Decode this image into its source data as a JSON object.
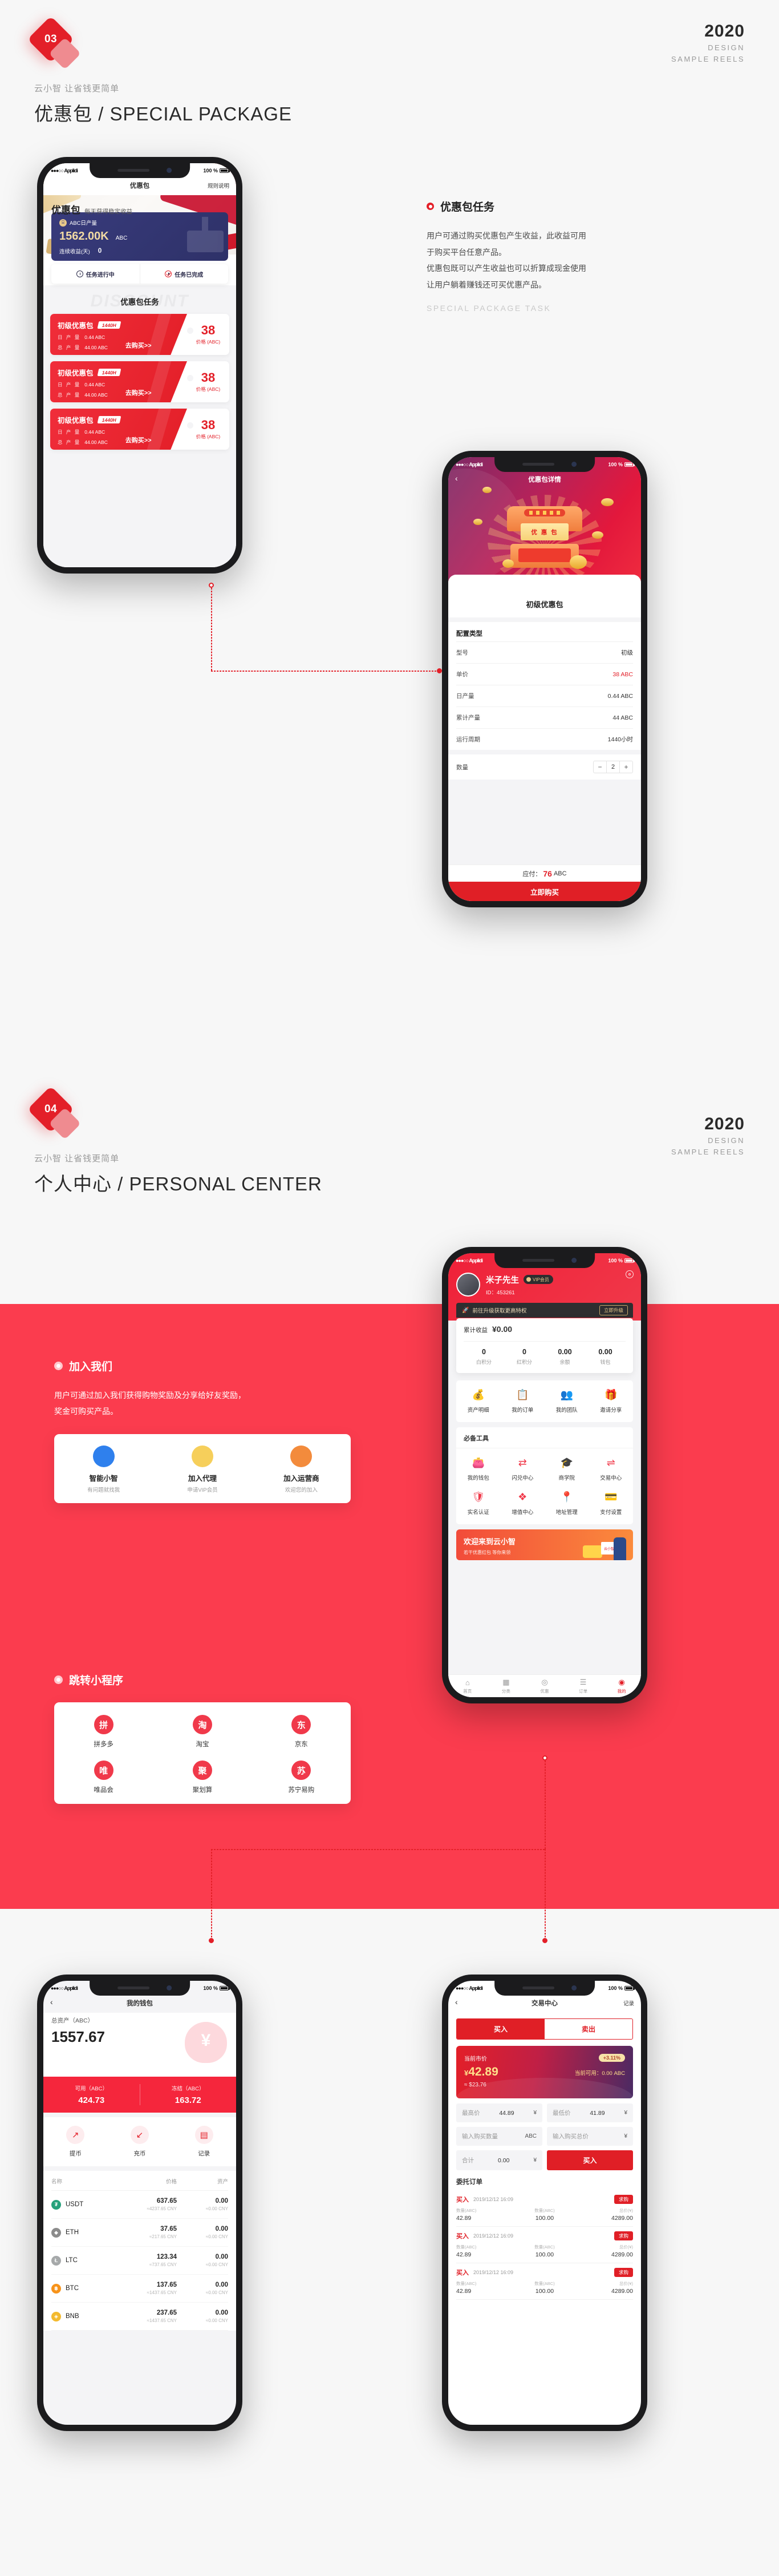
{
  "sections": [
    {
      "number": "03",
      "kicker": "云小智 让省钱更简单",
      "title": "优惠包 /  SPECIAL PACKAGE",
      "year": "2020",
      "meta_line1": "DESIGN",
      "meta_line2": "SAMPLE REELS"
    },
    {
      "number": "04",
      "kicker": "云小智 让省钱更简单",
      "title": "个人中心 /  PERSONAL CENTER",
      "year": "2020",
      "meta_line1": "DESIGN",
      "meta_line2": "SAMPLE REELS"
    }
  ],
  "statusbar": {
    "carrier": "Applidi",
    "battery": "100 %"
  },
  "phone_package_list": {
    "nav_title": "优惠包",
    "nav_right": "规则说明",
    "hero_title": "优惠包",
    "hero_sub": "每天获得稳定收益",
    "card_label": "ABC日产量",
    "card_amount": "1562.00K",
    "card_unit": "ABC",
    "card_days_label": "连续收益(天)",
    "card_days_value": "0",
    "tab_running": "任务进行中",
    "tab_done": "任务已完成",
    "watermark": "DISCOUNT",
    "list_title": "优惠包任务",
    "packages": [
      {
        "name": "初级优惠包",
        "hours": "1440H",
        "daily_label": "日 产 量",
        "daily_value": "0.44 ABC",
        "total_label": "总 产 量",
        "total_value": "44.00 ABC",
        "buy": "去购买>>",
        "price": "38",
        "price_label": "价格 (ABC)"
      },
      {
        "name": "初级优惠包",
        "hours": "1440H",
        "daily_label": "日 产 量",
        "daily_value": "0.44 ABC",
        "total_label": "总 产 量",
        "total_value": "44.00 ABC",
        "buy": "去购买>>",
        "price": "38",
        "price_label": "价格 (ABC)"
      },
      {
        "name": "初级优惠包",
        "hours": "1440H",
        "daily_label": "日 产 量",
        "daily_value": "0.44 ABC",
        "total_label": "总 产 量",
        "total_value": "44.00 ABC",
        "buy": "去购买>>",
        "price": "38",
        "price_label": "价格 (ABC)"
      }
    ]
  },
  "desc_package": {
    "heading": "优惠包任务",
    "para1": "用户可通过购买优惠包产生收益，此收益可用",
    "para2": "于购买平台任意产品。",
    "para3": "优惠包既可以产生收益也可以折算成现金使用",
    "para4": "让用户躺着赚钱还可买优惠产品。",
    "english": "SPECIAL PACKAGE TASK"
  },
  "phone_package_detail": {
    "nav_title": "优惠包详情",
    "chest_label": "优 惠 包",
    "product_name": "初级优惠包",
    "section_title": "配置类型",
    "rows": [
      {
        "key": "型号",
        "value": "初级",
        "red": false
      },
      {
        "key": "单价",
        "value": "38 ABC",
        "red": true
      },
      {
        "key": "日产量",
        "value": "0.44 ABC",
        "red": false
      },
      {
        "key": "累计产量",
        "value": "44 ABC",
        "red": false
      },
      {
        "key": "运行周期",
        "value": "1440小时",
        "red": false
      }
    ],
    "qty_label": "数量",
    "qty_minus": "−",
    "qty_value": "2",
    "qty_plus": "+",
    "pay_label": "应付：",
    "pay_amount": "76",
    "pay_unit": "ABC",
    "buy_button": "立即购买"
  },
  "join_us": {
    "heading": "加入我们",
    "para1": "用户可通过加入我们获得购物奖励及分享给好友奖励，",
    "para2": "奖金可购买产品。",
    "cards": [
      {
        "title": "智能小智",
        "sub": "有问题就找我",
        "color": "#2f80ed"
      },
      {
        "title": "加入代理",
        "sub": "申请VIP会员",
        "color": "#f6cf5b"
      },
      {
        "title": "加入运营商",
        "sub": "欢迎您的加入",
        "color": "#f38b3c"
      }
    ]
  },
  "mini_programs": {
    "heading": "跳转小程序",
    "items": [
      {
        "label": "拼多多",
        "glyph": "拼"
      },
      {
        "label": "淘宝",
        "glyph": "淘"
      },
      {
        "label": "京东",
        "glyph": "东"
      },
      {
        "label": "唯品会",
        "glyph": "唯"
      },
      {
        "label": "聚划算",
        "glyph": "聚"
      },
      {
        "label": "苏宁易购",
        "glyph": "苏"
      }
    ]
  },
  "phone_personal": {
    "user_name": "米子先生",
    "vip_badge": "VIP会员",
    "user_id": "ID：453261",
    "upgrade_text": "前往升级获取更高特权",
    "upgrade_button": "立即升级",
    "earn_label": "累计收益",
    "earn_value": "¥0.00",
    "stats": [
      {
        "value": "0",
        "label": "白积分"
      },
      {
        "value": "0",
        "label": "红积分"
      },
      {
        "value": "0.00",
        "label": "余额"
      },
      {
        "value": "0.00",
        "label": "钱包"
      }
    ],
    "quick": [
      {
        "label": "资产明细",
        "glyph": "💰"
      },
      {
        "label": "我的订单",
        "glyph": "📋"
      },
      {
        "label": "我的团队",
        "glyph": "👥"
      },
      {
        "label": "邀请分享",
        "glyph": "🎁"
      }
    ],
    "tools_title": "必备工具",
    "tools": [
      {
        "label": "我的钱包",
        "glyph": "👛"
      },
      {
        "label": "闪兑中心",
        "glyph": "⇄"
      },
      {
        "label": "商学院",
        "glyph": "🎓"
      },
      {
        "label": "交易中心",
        "glyph": "⇌"
      },
      {
        "label": "实名认证",
        "glyph": "🛡"
      },
      {
        "label": "增值中心",
        "glyph": "❖"
      },
      {
        "label": "地址管理",
        "glyph": "📍"
      },
      {
        "label": "支付设置",
        "glyph": "💳"
      }
    ],
    "banner_title": "欢迎来到云小智",
    "banner_sub": "若干优惠红包 等你来领",
    "banner_tag": "云小智",
    "tabbar": [
      {
        "label": "首页",
        "glyph": "⌂",
        "active": false
      },
      {
        "label": "分类",
        "glyph": "▦",
        "active": false
      },
      {
        "label": "优惠",
        "glyph": "◎",
        "active": false
      },
      {
        "label": "订单",
        "glyph": "☰",
        "active": false
      },
      {
        "label": "我的",
        "glyph": "◉",
        "active": true
      }
    ]
  },
  "phone_wallet": {
    "nav_title": "我的钱包",
    "total_label": "总资产（ABC）",
    "total_value": "1557.67",
    "available_label": "可用（ABC）",
    "available_value": "424.73",
    "frozen_label": "冻结（ABC）",
    "frozen_value": "163.72",
    "actions": [
      {
        "label": "提币",
        "glyph": "↗"
      },
      {
        "label": "充币",
        "glyph": "↙"
      },
      {
        "label": "记录",
        "glyph": "▤"
      }
    ],
    "col_name": "名称",
    "col_price": "价格",
    "col_asset": "资产",
    "coins": [
      {
        "symbol": "USDT",
        "glyph": "₮",
        "color": "#26a17b",
        "price": "637.65",
        "price_cny": "≈4237.65 CNY",
        "asset": "0.00",
        "asset_cny": "≈0.00 CNY"
      },
      {
        "symbol": "ETH",
        "glyph": "◆",
        "color": "#8c8c8c",
        "price": "37.65",
        "price_cny": "≈217.65 CNY",
        "asset": "0.00",
        "asset_cny": "≈0.00 CNY"
      },
      {
        "symbol": "LTC",
        "glyph": "Ł",
        "color": "#a6a9aa",
        "price": "123.34",
        "price_cny": "≈737.65 CNY",
        "asset": "0.00",
        "asset_cny": "≈0.00 CNY"
      },
      {
        "symbol": "BTC",
        "glyph": "฿",
        "color": "#f7931a",
        "price": "137.65",
        "price_cny": "≈1437.65 CNY",
        "asset": "0.00",
        "asset_cny": "≈0.00 CNY"
      },
      {
        "symbol": "BNB",
        "glyph": "◈",
        "color": "#f3ba2f",
        "price": "237.65",
        "price_cny": "≈1437.65 CNY",
        "asset": "0.00",
        "asset_cny": "≈0.00 CNY"
      }
    ]
  },
  "phone_trade": {
    "nav_title": "交易中心",
    "nav_right": "记录",
    "tab_buy": "买入",
    "tab_sell": "卖出",
    "market_label": "当前市价",
    "market_price": "42.89",
    "market_currency": "¥",
    "market_usd": "≈ $23.76",
    "change": "+3.11%",
    "available": "当前可用：0.00 ABC",
    "high_label": "最高价",
    "high_value": "44.89",
    "high_unit": "¥",
    "low_label": "最低价",
    "low_value": "41.89",
    "low_unit": "¥",
    "qty_placeholder": "输入购买数量",
    "qty_unit": "ABC",
    "total_placeholder": "输入购买总价",
    "total_unit": "¥",
    "sum_label": "合计",
    "sum_value": "0.00",
    "sum_unit": "¥",
    "submit": "买入",
    "orders_title": "委托订单",
    "orders": [
      {
        "side": "买入",
        "time": "2019/12/12 16:09",
        "action": "求购",
        "price_label": "数量(ABC)",
        "price_value": "42.89",
        "qty_label": "数量(ABC)",
        "qty_value": "100.00",
        "total_label": "总价(¥)",
        "total_value": "4289.00"
      },
      {
        "side": "买入",
        "time": "2019/12/12 16:09",
        "action": "求购",
        "price_label": "数量(ABC)",
        "price_value": "42.89",
        "qty_label": "数量(ABC)",
        "qty_value": "100.00",
        "total_label": "总价(¥)",
        "total_value": "4289.00"
      },
      {
        "side": "买入",
        "time": "2019/12/12 16:09",
        "action": "求购",
        "price_label": "数量(ABC)",
        "price_value": "42.89",
        "qty_label": "数量(ABC)",
        "qty_value": "100.00",
        "total_label": "总价(¥)",
        "total_value": "4289.00"
      }
    ]
  },
  "colors": {
    "brand_red": "#e31f28",
    "panel_red": "#fb3c4e",
    "navy": "#383b7c",
    "gold": "#e8c98a"
  }
}
